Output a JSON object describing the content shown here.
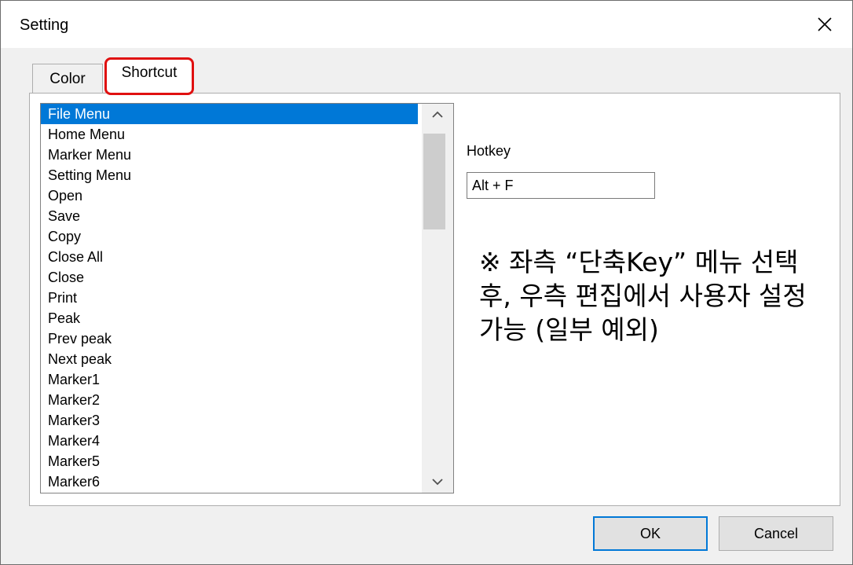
{
  "window": {
    "title": "Setting"
  },
  "tabs": [
    {
      "label": "Color"
    },
    {
      "label": "Shortcut"
    }
  ],
  "shortcut_list": {
    "selected": "File Menu",
    "items": [
      "File Menu",
      "Home Menu",
      "Marker Menu",
      "Setting Menu",
      "Open",
      "Save",
      "Copy",
      "Close All",
      "Close",
      "Print",
      "Peak",
      "Prev peak",
      "Next peak",
      "Marker1",
      "Marker2",
      "Marker3",
      "Marker4",
      "Marker5",
      "Marker6"
    ]
  },
  "hotkey": {
    "label": "Hotkey",
    "value": "Alt + F"
  },
  "note": "※ 좌측 “단축Key” 메뉴 선택 후, 우측 편집에서 사용자 설정 가능 (일부 예외)",
  "buttons": {
    "ok": "OK",
    "cancel": "Cancel"
  },
  "colors": {
    "selection": "#0078d7",
    "highlight_box": "#e01010"
  },
  "icons": {
    "close": "close-icon",
    "scroll_up": "chevron-up-icon",
    "scroll_down": "chevron-down-icon"
  }
}
